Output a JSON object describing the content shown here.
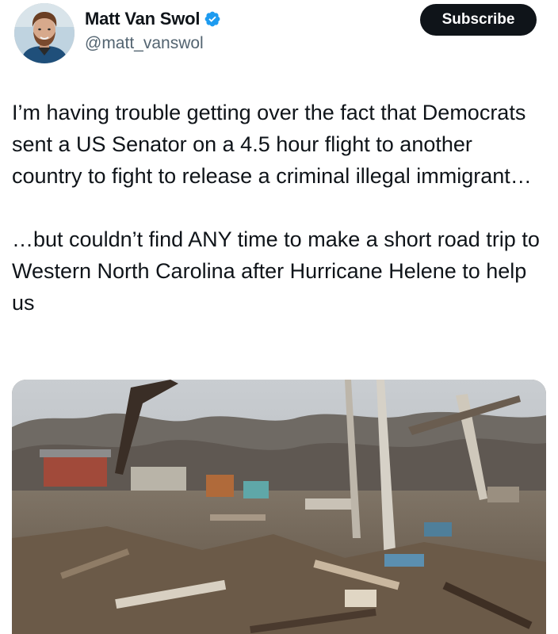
{
  "author": {
    "display_name": "Matt Van Swol",
    "handle": "@matt_vanswol",
    "verified": true,
    "avatar_icon": "avatar-photo",
    "verified_icon": "verified-badge-icon",
    "verified_color": "#1d9bf0"
  },
  "actions": {
    "subscribe_label": "Subscribe"
  },
  "tweet": {
    "paragraphs": [
      "I’m having trouble getting over the fact that Democrats sent a US Senator on a 4.5 hour flight to another country to fight to release a criminal illegal immigrant…",
      "…but couldn’t find ANY time to make a short road trip to Western North Carolina after Hurricane Helene to help us"
    ]
  },
  "media": {
    "type": "video-thumbnail",
    "subject": "storm-damage-debris"
  }
}
